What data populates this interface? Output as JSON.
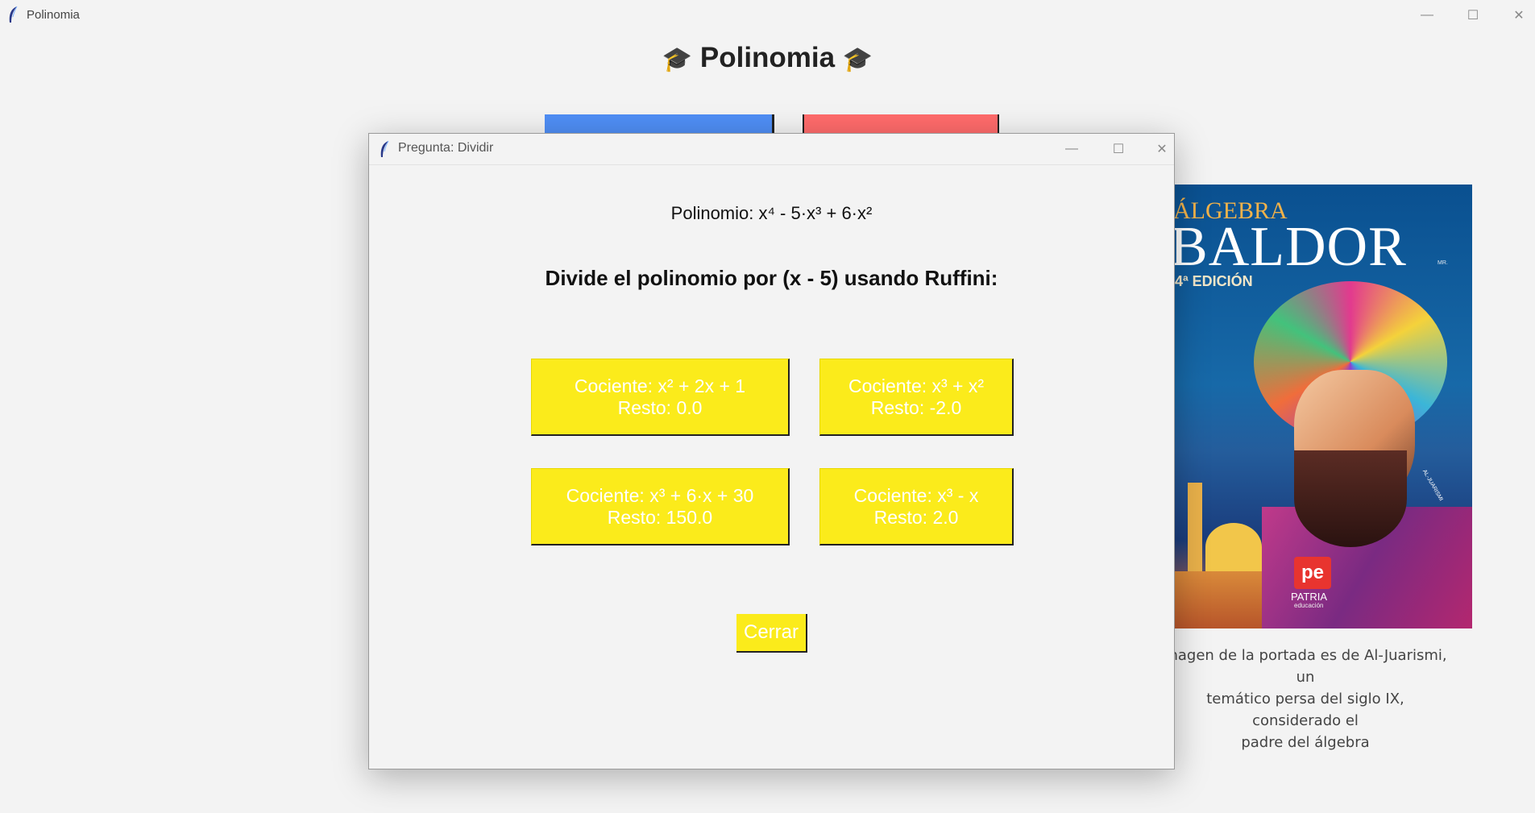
{
  "main_window": {
    "title": "Polinomia",
    "heading": "Polinomia",
    "heading_icon": "graduation-cap-icon",
    "heading_glyph": "🎓",
    "controls": {
      "minimize": "—",
      "maximize": "☐",
      "close": "✕"
    }
  },
  "cover": {
    "title_line1": "ÁLGEBRA",
    "title_line2": "BALDOR",
    "mark": "MR.",
    "edition": "4ª EDICIÓN",
    "author_text": "AL-JUARISMI",
    "publisher_logo": "pe",
    "publisher": "PATRIA",
    "publisher_sub": "educación",
    "caption_line1": "magen de la portada es de Al-Juarismi, un",
    "caption_line2": "temático persa del siglo IX, considerado el",
    "caption_line3": "padre del álgebra"
  },
  "dialog": {
    "title": "Pregunta: Dividir",
    "controls": {
      "minimize": "—",
      "maximize": "☐",
      "close": "✕"
    },
    "polynomial": "Polinomio: x⁴  - 5·x³  + 6·x²",
    "question": "Divide el polinomio por (x - 5) usando Ruffini:",
    "options": [
      {
        "line1": "Cociente: x² + 2x + 1",
        "line2": "Resto: 0.0"
      },
      {
        "line1": "Cociente: x³ + x²",
        "line2": "Resto: -2.0"
      },
      {
        "line1": "Cociente: x³  + 6·x  + 30",
        "line2": "Resto: 150.0"
      },
      {
        "line1": "Cociente: x³ - x",
        "line2": "Resto: 2.0"
      }
    ],
    "close_button": "Cerrar"
  },
  "colors": {
    "option_yellow": "#fbeb1b",
    "button_blue": "#4f8ef5",
    "button_red": "#ff6b6b",
    "background": "#f3f3f3"
  }
}
